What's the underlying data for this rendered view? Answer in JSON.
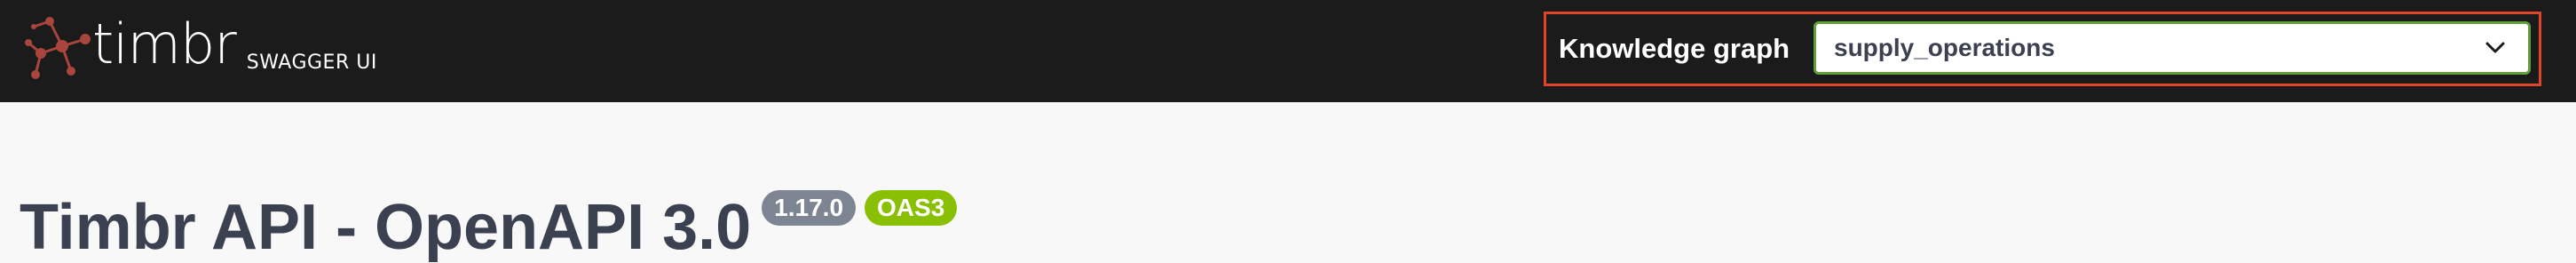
{
  "header": {
    "logo_text": "timbr",
    "logo_subtitle": "SWAGGER UI",
    "knowledge_graph": {
      "label": "Knowledge graph",
      "selected": "supply_operations"
    }
  },
  "main": {
    "title": "Timbr API - OpenAPI 3.0",
    "version_badge": "1.17.0",
    "spec_badge": "OAS3"
  },
  "colors": {
    "topbar": "#1b1b1b",
    "highlight": "#e0452b",
    "select_border": "#62a03f",
    "version_badge": "#7d8492",
    "oas_badge": "#89bf04",
    "title_text": "#3b4151",
    "logo_mark": "#a8453d"
  },
  "icons": {
    "logo": "timbr-molecule-icon",
    "select": "chevron-down-icon"
  }
}
